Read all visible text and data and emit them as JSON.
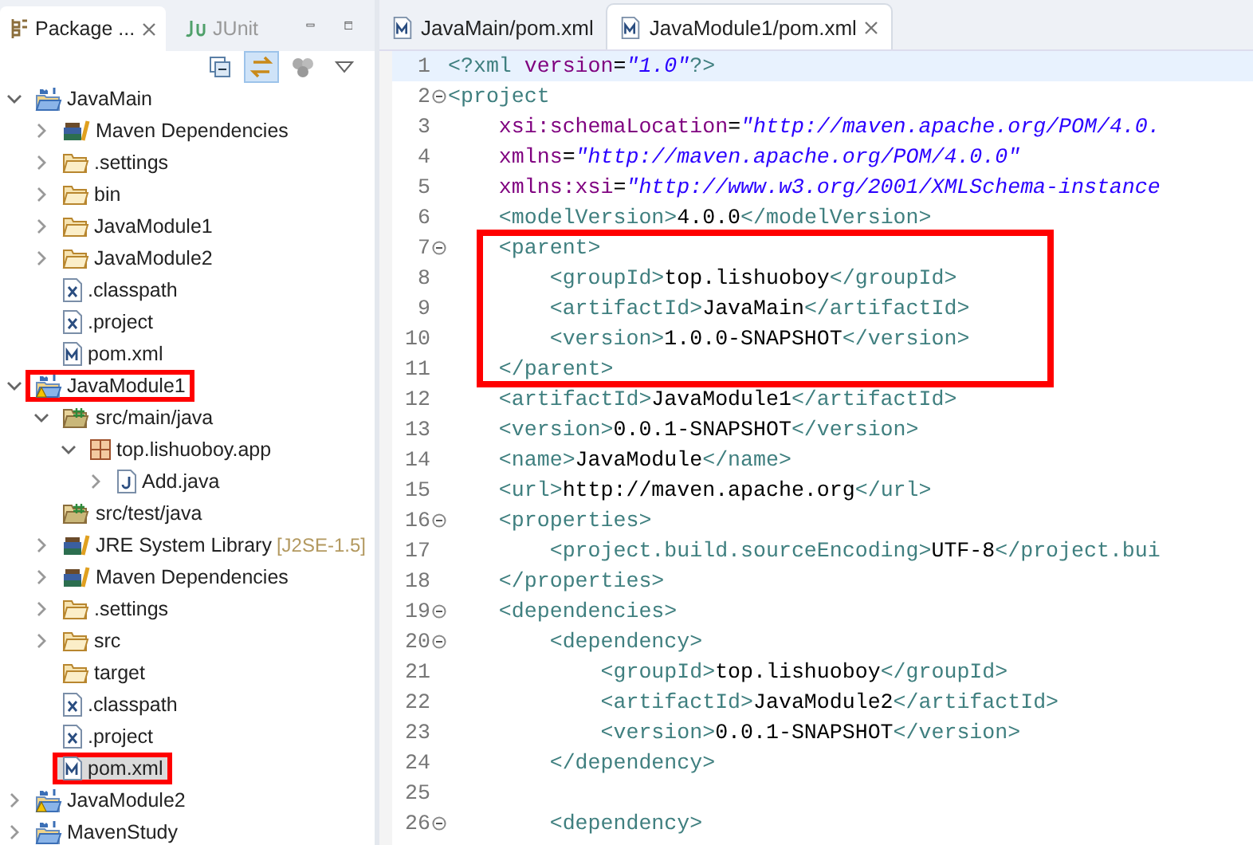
{
  "explorer": {
    "tabs": [
      {
        "label": "Package ...",
        "selected": true,
        "closable": true
      },
      {
        "label": "JUnit",
        "selected": false,
        "closable": false
      }
    ],
    "toolbar": [
      {
        "kind": "collapse",
        "pressed": false
      },
      {
        "kind": "link",
        "pressed": true
      },
      {
        "kind": "working-sets",
        "pressed": false
      },
      {
        "kind": "menu",
        "pressed": false
      }
    ],
    "tree": [
      {
        "label": "JavaMain",
        "kind": "maven-project",
        "expanded": true,
        "selected": false,
        "highlighted": false,
        "children": [
          {
            "label": "Maven Dependencies",
            "kind": "library",
            "expanded": false,
            "selected": false,
            "highlighted": false
          },
          {
            "label": ".settings",
            "kind": "folder",
            "expanded": false,
            "selected": false,
            "highlighted": false
          },
          {
            "label": "bin",
            "kind": "folder",
            "expanded": false,
            "selected": false,
            "highlighted": false
          },
          {
            "label": "JavaModule1",
            "kind": "folder",
            "expanded": false,
            "selected": false,
            "highlighted": false
          },
          {
            "label": "JavaModule2",
            "kind": "folder",
            "expanded": false,
            "selected": false,
            "highlighted": false
          },
          {
            "label": ".classpath",
            "kind": "xml-file",
            "selected": false,
            "highlighted": false
          },
          {
            "label": ".project",
            "kind": "xml-file",
            "selected": false,
            "highlighted": false
          },
          {
            "label": "pom.xml",
            "kind": "pom-file",
            "selected": false,
            "highlighted": false
          }
        ]
      },
      {
        "label": "JavaModule1",
        "kind": "maven-project-warning",
        "expanded": true,
        "selected": false,
        "highlighted": true,
        "children": [
          {
            "label": "src/main/java",
            "kind": "source-folder",
            "expanded": true,
            "selected": false,
            "highlighted": false,
            "children": [
              {
                "label": "top.lishuoboy.app",
                "kind": "package",
                "expanded": true,
                "selected": false,
                "highlighted": false,
                "children": [
                  {
                    "label": "Add.java",
                    "kind": "java-file",
                    "expanded": false,
                    "selected": false,
                    "highlighted": false
                  }
                ]
              }
            ]
          },
          {
            "label": "src/test/java",
            "kind": "source-folder",
            "selected": false,
            "highlighted": false
          },
          {
            "label": "JRE System Library",
            "detail": "[J2SE-1.5]",
            "kind": "library",
            "expanded": false,
            "selected": false,
            "highlighted": false
          },
          {
            "label": "Maven Dependencies",
            "kind": "library",
            "expanded": false,
            "selected": false,
            "highlighted": false
          },
          {
            "label": ".settings",
            "kind": "folder",
            "expanded": false,
            "selected": false,
            "highlighted": false
          },
          {
            "label": "src",
            "kind": "folder",
            "expanded": false,
            "selected": false,
            "highlighted": false
          },
          {
            "label": "target",
            "kind": "folder",
            "selected": false,
            "highlighted": false
          },
          {
            "label": ".classpath",
            "kind": "xml-file",
            "selected": false,
            "highlighted": false
          },
          {
            "label": ".project",
            "kind": "xml-file",
            "selected": false,
            "highlighted": false
          },
          {
            "label": "pom.xml",
            "kind": "pom-file",
            "selected": true,
            "highlighted": true
          }
        ]
      },
      {
        "label": "JavaModule2",
        "kind": "maven-project-warning",
        "expanded": false,
        "selected": false,
        "highlighted": false
      },
      {
        "label": "MavenStudy",
        "kind": "maven-project",
        "expanded": false,
        "selected": false,
        "highlighted": false
      }
    ]
  },
  "editor": {
    "tabs": [
      {
        "label": "JavaMain/pom.xml",
        "selected": false,
        "closable": false
      },
      {
        "label": "JavaModule1/pom.xml",
        "selected": true,
        "closable": true
      }
    ],
    "blocks": [
      {
        "highlighted": false,
        "lines": [
          {
            "number": "1",
            "foldable": false,
            "current": true,
            "tokens": [
              {
                "kind": "tag",
                "text": "<?xml"
              },
              {
                "kind": "attr",
                "text": " version"
              },
              {
                "kind": "text",
                "text": "="
              },
              {
                "kind": "string",
                "text": "\"1.0\""
              },
              {
                "kind": "tag",
                "text": "?>"
              }
            ]
          },
          {
            "number": "2",
            "foldable": true,
            "current": false,
            "tokens": [
              {
                "kind": "tag",
                "text": "<project"
              }
            ]
          },
          {
            "number": "3",
            "foldable": false,
            "current": false,
            "tokens": [
              {
                "kind": "attr",
                "text": "    xsi:schemaLocation"
              },
              {
                "kind": "text",
                "text": "="
              },
              {
                "kind": "string",
                "text": "\"http://maven.apache.org/POM/4.0."
              }
            ]
          },
          {
            "number": "4",
            "foldable": false,
            "current": false,
            "tokens": [
              {
                "kind": "attr",
                "text": "    xmlns"
              },
              {
                "kind": "text",
                "text": "="
              },
              {
                "kind": "string",
                "text": "\"http://maven.apache.org/POM/4.0.0\""
              }
            ]
          },
          {
            "number": "5",
            "foldable": false,
            "current": false,
            "tokens": [
              {
                "kind": "attr",
                "text": "    xmlns:xsi"
              },
              {
                "kind": "text",
                "text": "="
              },
              {
                "kind": "string",
                "text": "\"http://www.w3.org/2001/XMLSchema-instance"
              }
            ]
          },
          {
            "number": "6",
            "foldable": false,
            "current": false,
            "tokens": [
              {
                "kind": "tag",
                "text": "    <modelVersion>"
              },
              {
                "kind": "text",
                "text": "4.0.0"
              },
              {
                "kind": "tag",
                "text": "</modelVersion>"
              }
            ]
          }
        ]
      },
      {
        "highlighted": true,
        "lines": [
          {
            "number": "7",
            "foldable": true,
            "current": false,
            "tokens": [
              {
                "kind": "tag",
                "text": "    <parent>"
              }
            ]
          },
          {
            "number": "8",
            "foldable": false,
            "current": false,
            "tokens": [
              {
                "kind": "tag",
                "text": "        <groupId>"
              },
              {
                "kind": "text",
                "text": "top.lishuoboy"
              },
              {
                "kind": "tag",
                "text": "</groupId>"
              }
            ]
          },
          {
            "number": "9",
            "foldable": false,
            "current": false,
            "tokens": [
              {
                "kind": "tag",
                "text": "        <artifactId>"
              },
              {
                "kind": "text",
                "text": "JavaMain"
              },
              {
                "kind": "tag",
                "text": "</artifactId>"
              }
            ]
          },
          {
            "number": "10",
            "foldable": false,
            "current": false,
            "tokens": [
              {
                "kind": "tag",
                "text": "        <version>"
              },
              {
                "kind": "text",
                "text": "1.0.0-SNAPSHOT"
              },
              {
                "kind": "tag",
                "text": "</version>"
              }
            ]
          },
          {
            "number": "11",
            "foldable": false,
            "current": false,
            "tokens": [
              {
                "kind": "tag",
                "text": "    </parent>"
              }
            ]
          }
        ]
      },
      {
        "highlighted": false,
        "lines": [
          {
            "number": "12",
            "foldable": false,
            "current": false,
            "tokens": [
              {
                "kind": "tag",
                "text": "    <artifactId>"
              },
              {
                "kind": "text",
                "text": "JavaModule1"
              },
              {
                "kind": "tag",
                "text": "</artifactId>"
              }
            ]
          },
          {
            "number": "13",
            "foldable": false,
            "current": false,
            "tokens": [
              {
                "kind": "tag",
                "text": "    <version>"
              },
              {
                "kind": "text",
                "text": "0.0.1-SNAPSHOT"
              },
              {
                "kind": "tag",
                "text": "</version>"
              }
            ]
          },
          {
            "number": "14",
            "foldable": false,
            "current": false,
            "tokens": [
              {
                "kind": "tag",
                "text": "    <name>"
              },
              {
                "kind": "text",
                "text": "JavaModule"
              },
              {
                "kind": "tag",
                "text": "</name>"
              }
            ]
          },
          {
            "number": "15",
            "foldable": false,
            "current": false,
            "tokens": [
              {
                "kind": "tag",
                "text": "    <url>"
              },
              {
                "kind": "text",
                "text": "http://maven.apache.org"
              },
              {
                "kind": "tag",
                "text": "</url>"
              }
            ]
          },
          {
            "number": "16",
            "foldable": true,
            "current": false,
            "tokens": [
              {
                "kind": "tag",
                "text": "    <properties>"
              }
            ]
          },
          {
            "number": "17",
            "foldable": false,
            "current": false,
            "tokens": [
              {
                "kind": "tag",
                "text": "        <project.build.sourceEncoding>"
              },
              {
                "kind": "text",
                "text": "UTF-8"
              },
              {
                "kind": "tag",
                "text": "</project.bui"
              }
            ]
          },
          {
            "number": "18",
            "foldable": false,
            "current": false,
            "tokens": [
              {
                "kind": "tag",
                "text": "    </properties>"
              }
            ]
          },
          {
            "number": "19",
            "foldable": true,
            "current": false,
            "tokens": [
              {
                "kind": "tag",
                "text": "    <dependencies>"
              }
            ]
          },
          {
            "number": "20",
            "foldable": true,
            "current": false,
            "tokens": [
              {
                "kind": "tag",
                "text": "        <dependency>"
              }
            ]
          },
          {
            "number": "21",
            "foldable": false,
            "current": false,
            "tokens": [
              {
                "kind": "tag",
                "text": "            <groupId>"
              },
              {
                "kind": "text",
                "text": "top.lishuoboy"
              },
              {
                "kind": "tag",
                "text": "</groupId>"
              }
            ]
          },
          {
            "number": "22",
            "foldable": false,
            "current": false,
            "tokens": [
              {
                "kind": "tag",
                "text": "            <artifactId>"
              },
              {
                "kind": "text",
                "text": "JavaModule2"
              },
              {
                "kind": "tag",
                "text": "</artifactId>"
              }
            ]
          },
          {
            "number": "23",
            "foldable": false,
            "current": false,
            "tokens": [
              {
                "kind": "tag",
                "text": "            <version>"
              },
              {
                "kind": "text",
                "text": "0.0.1-SNAPSHOT"
              },
              {
                "kind": "tag",
                "text": "</version>"
              }
            ]
          },
          {
            "number": "24",
            "foldable": false,
            "current": false,
            "tokens": [
              {
                "kind": "tag",
                "text": "        </dependency>"
              }
            ]
          },
          {
            "number": "25",
            "foldable": false,
            "current": false
          },
          {
            "number": "26",
            "foldable": true,
            "current": false,
            "tokens": [
              {
                "kind": "tag",
                "text": "        <dependency>"
              }
            ]
          }
        ]
      }
    ]
  }
}
